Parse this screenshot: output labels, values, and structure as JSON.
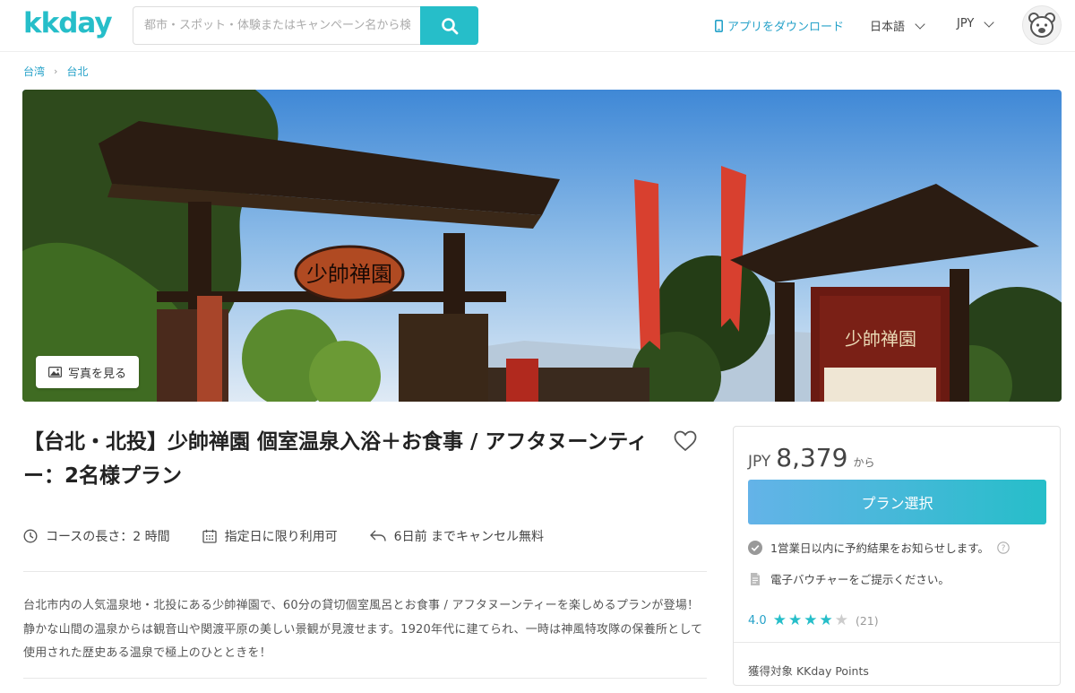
{
  "header": {
    "logo": "kkday",
    "search_placeholder": "都市・スポット・体験またはキャンペーン名から検索",
    "app_download": "アプリをダウンロード",
    "language": "日本語",
    "currency": "JPY"
  },
  "breadcrumb": [
    "台湾",
    "台北"
  ],
  "hero": {
    "photo_button": "写真を見る"
  },
  "product": {
    "title": "【台北・北投】少帥禅園 個室温泉入浴＋お食事 / アフタヌーンティー：2名様プラン",
    "duration": "コースの長さ：2 時間",
    "date_note": "指定日に限り利用可",
    "cancel_note": "6日前 までキャンセル無料",
    "description": "台北市内の人気温泉地・北投にある少帥禅園で、60分の貸切個室風呂とお食事 / アフタヌーンティーを楽しめるプランが登場！ 静かな山間の温泉からは観音山や関渡平原の美しい景観が見渡せます。1920年代に建てられ、一時は神風特攻隊の保養所として使用された歴史ある温泉で極上のひとときを！"
  },
  "price_box": {
    "currency": "JPY",
    "price": "8,379",
    "from": "から",
    "book_button": "プラン選択",
    "confirm_note": "1営業日以内に予約結果をお知らせします。",
    "voucher_note": "電子バウチャーをご提示ください。",
    "rating": "4.0",
    "rating_stars": 4,
    "review_count": "(21)",
    "points": "獲得対象 KKday Points"
  },
  "colors": {
    "accent": "#26bec9",
    "link": "#26a2c9"
  }
}
